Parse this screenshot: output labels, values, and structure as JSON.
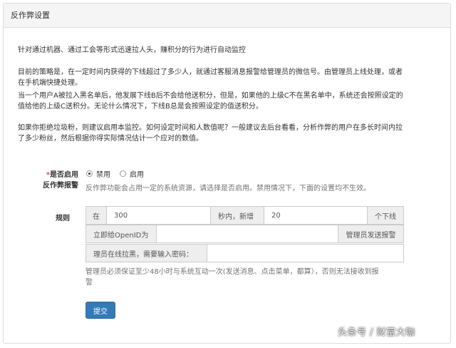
{
  "panel": {
    "title": "反作弊设置"
  },
  "intro": {
    "line1": "针对通过机器、通过工会等形式迅速拉人头，赚积分的行为进行自动监控",
    "para2_l1": "目前的策略是，在一定时间内获得的下线超过了多少人，就通过客服消息报警给管理员的微信号。由管理员上线处理，或者",
    "para2_l2": "在手机端快捷处理。",
    "para3_l1": "当一个用户A被拉入黑名单后，他发展下线B后不会给他送积分，但是，如果他的上级C不在黑名单中，系统还会按照设定的",
    "para3_l2": "值给他的上级C送积分。无论什么情况下，下线B总是会按照设定的值送积分。",
    "para4_l1": "如果你拒绝垃圾粉，则建议启用本监控。如何设定时间和人数值呢？一般建议去后台看看，分析作弊的用户在多长时间内拉",
    "para4_l2": "了多少粉丝，然后根据你得实际情况估计一个应对的数值。"
  },
  "enable": {
    "required_mark": "*",
    "label_l1": "是否启用",
    "label_l2": "反作弊报警",
    "option_off": "禁用",
    "option_on": "启用",
    "selected": "禁用",
    "help": "反作弊功能会占用一定的系统资源，请选择是否启用。禁用情况下，下面的设置均不生效。"
  },
  "rules": {
    "label": "规则",
    "prefix": "在",
    "seconds_value": "300",
    "mid_text": "秒内，新增",
    "count_value": "20",
    "suffix": "个下线",
    "openid_prefix": "立即给OpenID为",
    "openid_value": "",
    "openid_suffix": "管理员发送报警",
    "password_prefix": "理员在线拉黑，需要输入密码：",
    "password_value": "",
    "help_l1": "管理员必须保证至少48小时与系统互动一次(发送消息、点击菜单，都算），否则无法接收到报",
    "help_l2": "警"
  },
  "submit_label": "提交",
  "watermark": "头条号 / 财富大咖"
}
